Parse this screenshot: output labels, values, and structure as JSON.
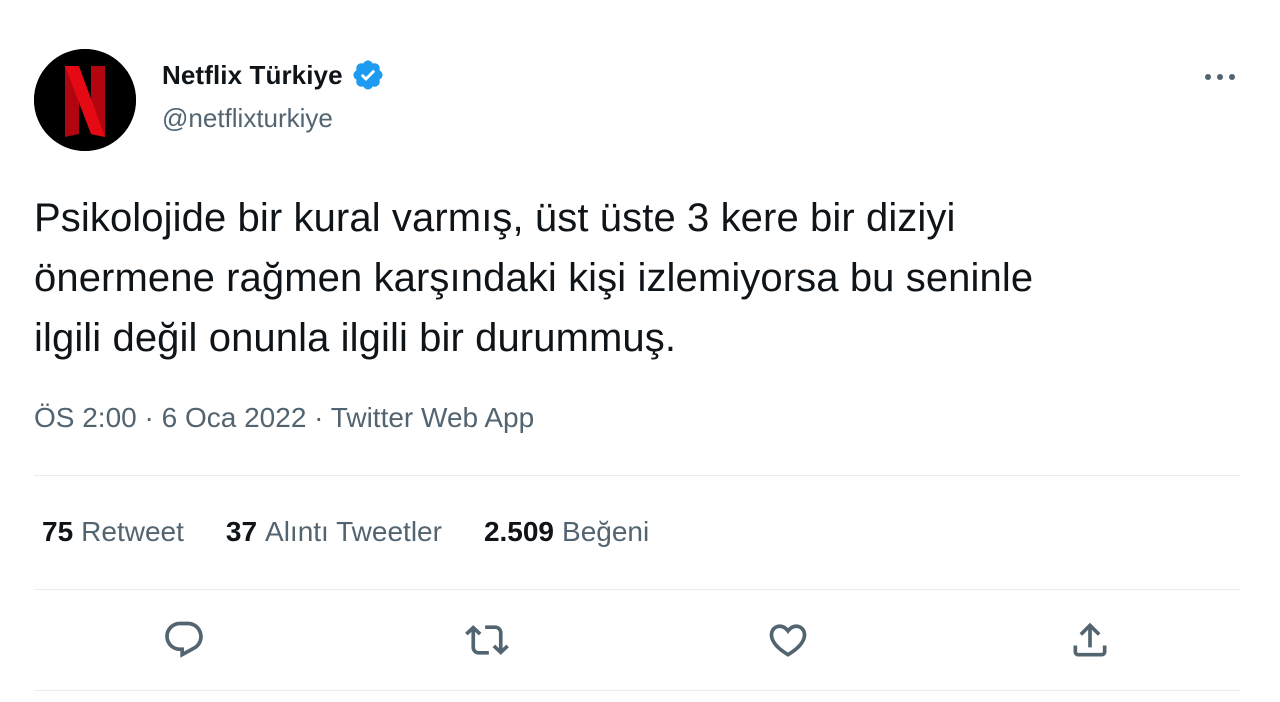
{
  "author": {
    "display_name": "Netflix Türkiye",
    "handle": "@netflixturkiye",
    "verified": true
  },
  "tweet": {
    "lines": [
      "Psikolojide bir kural varmış, üst üste 3 kere bir diziyi",
      "önermene rağmen karşındaki kişi izlemiyorsa bu seninle",
      "ilgili değil onunla ilgili bir durummuş."
    ]
  },
  "meta": {
    "time": "ÖS 2:00",
    "separator": " · ",
    "date": "6 Oca 2022",
    "source": "Twitter Web App"
  },
  "stats": {
    "retweets_count": "75",
    "retweets_label": "Retweet",
    "quotes_count": "37",
    "quotes_label": "Alıntı Tweetler",
    "likes_count": "2.509",
    "likes_label": "Beğeni"
  },
  "actions": [
    "reply-icon",
    "retweet-icon",
    "like-icon",
    "share-icon"
  ],
  "colors": {
    "text": "#0f1419",
    "secondary": "#536471",
    "verified": "#1d9bf0",
    "netflix_red": "#e50914",
    "divider": "#e6ecf0"
  }
}
